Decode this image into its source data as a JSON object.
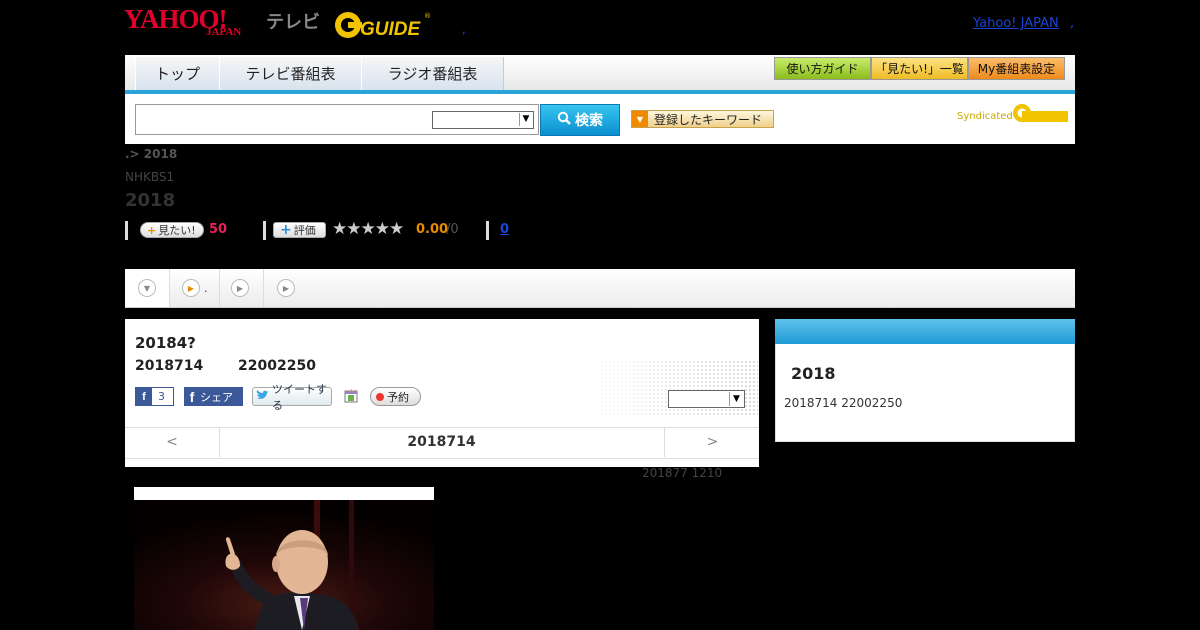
{
  "header": {
    "logo_yahoo": "YAHOO!",
    "logo_japan": "JAPAN",
    "logo_tv": "テレビ",
    "logo_gguide": "GUIDE",
    "dot": ",",
    "yahoo_japan_link": "Yahoo! JAPAN",
    "link_dot": ","
  },
  "nav": {
    "tabs": [
      {
        "label": "トップ"
      },
      {
        "label": "テレビ番組表"
      },
      {
        "label": "ラジオ番組表"
      }
    ],
    "guide_buttons": [
      {
        "label": "使い方ガイド",
        "color": "#9ccc2c"
      },
      {
        "label": "「見たい!」一覧",
        "color": "#f5c73a"
      },
      {
        "label": "My番組表設定",
        "color": "#f08a1e"
      }
    ]
  },
  "search": {
    "input_value": "",
    "select_value": "",
    "button_label": "検索",
    "keyword_button": "登録したキーワード",
    "syndicated": "Syndicated"
  },
  "program": {
    "breadcrumb": ".> 2018",
    "station": "NHKBS1",
    "title": "2018",
    "want_label": "見たい!",
    "want_count": "50",
    "rate_label": "評価",
    "stars": "★★★★★",
    "rating": "0.00",
    "rating_of": "/0",
    "comments": "0"
  },
  "tabs": {
    "tab2_suffix": "."
  },
  "episode": {
    "title": "20184?",
    "date": "2018714",
    "time": "22002250",
    "fb_count": "3",
    "fb_share": "シェア",
    "tweet": "ツイートする",
    "reserve": "予約",
    "select_value": "",
    "pager_prev": "<",
    "pager_mid": "2018714",
    "pager_next": ">",
    "note": "201877  1210"
  },
  "sidebar": {
    "title": "2018",
    "info": "2018714  22002250"
  },
  "colors": {
    "accent_blue": "#2aa3d9",
    "yahoo_red": "#e0002a",
    "gguide_yellow": "#f2c400"
  }
}
